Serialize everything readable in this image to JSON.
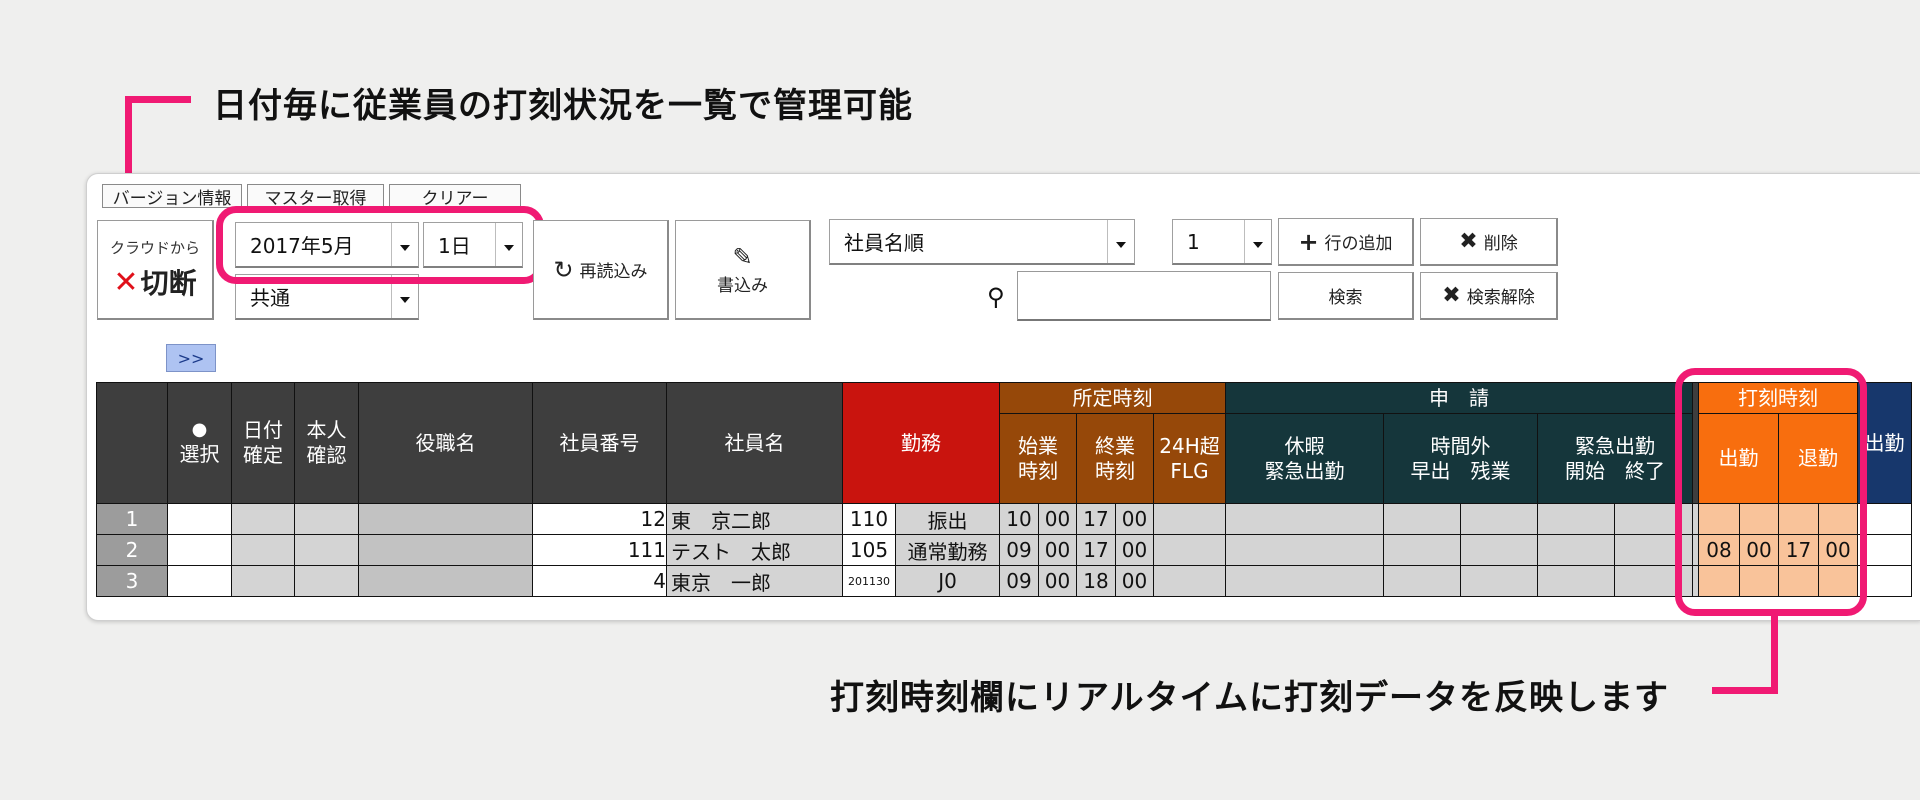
{
  "callouts": {
    "top": "日付毎に従業員の打刻状況を一覧で管理可能",
    "bottom": "打刻時刻欄にリアルタイムに打刻データを反映します"
  },
  "tabs": [
    "バージョン情報",
    "マスター取得",
    "クリアー"
  ],
  "toolbar": {
    "cloud_label": "クラウドから",
    "disconnect_label": "切断",
    "month_select": "2017年5月",
    "day_select": "1日",
    "common_select": "共通",
    "reload_label": "再読込み",
    "write_label": "書込み",
    "sort_select": "社員名順",
    "count_select": "1",
    "add_row_label": "行の追加",
    "delete_label": "削除",
    "search_label": "検索",
    "search_clear_label": "検索解除",
    "expand_label": ">>"
  },
  "table": {
    "headers": {
      "select": "選択",
      "date_confirm": [
        "日付",
        "確定"
      ],
      "self_confirm": [
        "本人",
        "確認"
      ],
      "position": "役職名",
      "emp_no": "社員番号",
      "emp_name": "社員名",
      "shift": "勤務",
      "scheduled": "所定時刻",
      "start_time": [
        "始業",
        "時刻"
      ],
      "end_time": [
        "終業",
        "時刻"
      ],
      "over24": [
        "24H超",
        "FLG"
      ],
      "request": "申　請",
      "leave": [
        "休暇",
        "緊急出勤"
      ],
      "overtime": [
        "時間外",
        "早出　残業"
      ],
      "emergency": [
        "緊急出勤",
        "開始　終了"
      ],
      "stamp": "打刻時刻",
      "clock_in": "出勤",
      "clock_out": "退勤",
      "extra": "出勤"
    },
    "rows": [
      {
        "num": "1",
        "emp_no": "12",
        "name": "東　京二郎",
        "code": "110",
        "shift": "振出",
        "start_h": "10",
        "start_m": "00",
        "end_h": "17",
        "end_m": "00",
        "in_h": "",
        "in_m": "",
        "out_h": "",
        "out_m": ""
      },
      {
        "num": "2",
        "emp_no": "111",
        "name": "テスト　太郎",
        "code": "105",
        "shift": "通常勤務",
        "start_h": "09",
        "start_m": "00",
        "end_h": "17",
        "end_m": "00",
        "in_h": "08",
        "in_m": "00",
        "out_h": "17",
        "out_m": "00"
      },
      {
        "num": "3",
        "emp_no": "4",
        "name": "東京　一郎",
        "code": "201130",
        "shift": "J0",
        "start_h": "09",
        "start_m": "00",
        "end_h": "18",
        "end_m": "00",
        "in_h": "",
        "in_m": "",
        "out_h": "",
        "out_m": ""
      }
    ]
  },
  "colors": {
    "accent_pink": "#f01a73",
    "header_dark": "#3e3e3e",
    "header_red": "#c9140e",
    "header_brown": "#964809",
    "header_teal": "#15363b",
    "header_orange": "#f86e0e",
    "stamp_cells": "#f9c39a"
  }
}
